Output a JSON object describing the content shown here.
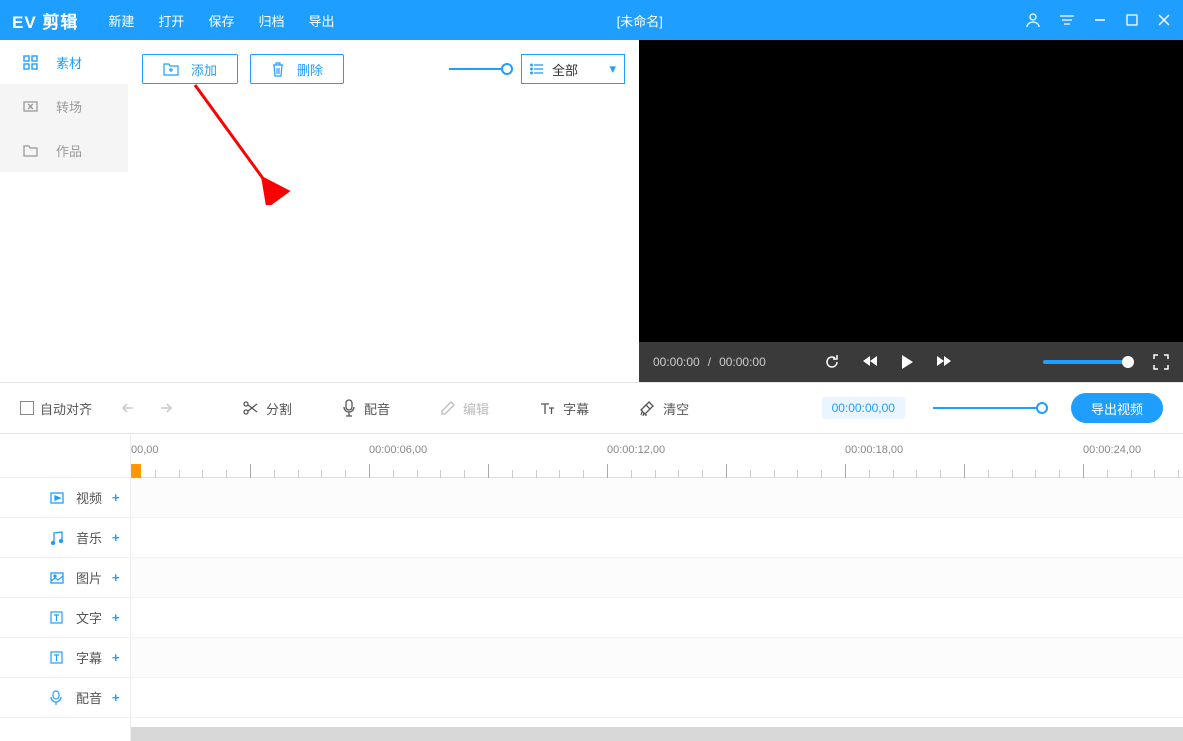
{
  "app": {
    "name": "EV 剪辑",
    "title": "[未命名]"
  },
  "menu": [
    "新建",
    "打开",
    "保存",
    "归档",
    "导出"
  ],
  "sidebar": [
    {
      "label": "素材",
      "active": true
    },
    {
      "label": "转场",
      "active": false
    },
    {
      "label": "作品",
      "active": false
    }
  ],
  "content": {
    "add_btn": "添加",
    "delete_btn": "删除",
    "filter_label": "全部"
  },
  "preview": {
    "time_current": "00:00:00",
    "time_total": "00:00:00"
  },
  "toolbar": {
    "auto_align": "自动对齐",
    "tools": [
      {
        "label": "分割",
        "icon": "scissors"
      },
      {
        "label": "配音",
        "icon": "mic"
      },
      {
        "label": "编辑",
        "icon": "pencil",
        "disabled": true
      },
      {
        "label": "字幕",
        "icon": "text"
      },
      {
        "label": "清空",
        "icon": "broom"
      }
    ],
    "time": "00:00:00,00",
    "export": "导出视频"
  },
  "ruler_marks": [
    {
      "label": "00,00",
      "pos": 0
    },
    {
      "label": "00:00:06,00",
      "pos": 238
    },
    {
      "label": "00:00:12,00",
      "pos": 476
    },
    {
      "label": "00:00:18,00",
      "pos": 714
    },
    {
      "label": "00:00:24,00",
      "pos": 952
    }
  ],
  "tracks": [
    {
      "label": "视频",
      "icon": "video"
    },
    {
      "label": "音乐",
      "icon": "music"
    },
    {
      "label": "图片",
      "icon": "image"
    },
    {
      "label": "文字",
      "icon": "text-box"
    },
    {
      "label": "字幕",
      "icon": "text-box"
    },
    {
      "label": "配音",
      "icon": "mic"
    }
  ]
}
